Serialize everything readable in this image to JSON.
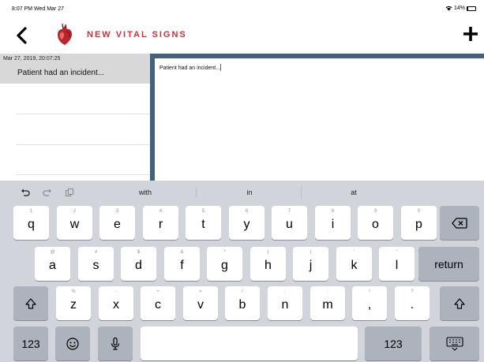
{
  "status_bar": {
    "time": "8:07 PM  Wed Mar 27",
    "battery_text": "14%",
    "battery_level": 0.14
  },
  "nav": {
    "title": "NEW VITAL SIGNS",
    "back_icon": "chevron-left-icon",
    "logo_icon": "heart-icon",
    "add_icon": "plus-icon"
  },
  "list": {
    "items": [
      {
        "date": "Mar 27, 2019, 20:07:25",
        "preview": "Patient had an incident..."
      }
    ]
  },
  "detail": {
    "text": "Patient had an incident..."
  },
  "keyboard": {
    "suggestions": [
      "with",
      "in",
      "at"
    ],
    "row1": [
      {
        "hint": "1",
        "key": "q"
      },
      {
        "hint": "2",
        "key": "w"
      },
      {
        "hint": "3",
        "key": "e"
      },
      {
        "hint": "4",
        "key": "r"
      },
      {
        "hint": "5",
        "key": "t"
      },
      {
        "hint": "6",
        "key": "y"
      },
      {
        "hint": "7",
        "key": "u"
      },
      {
        "hint": "8",
        "key": "i"
      },
      {
        "hint": "9",
        "key": "o"
      },
      {
        "hint": "0",
        "key": "p"
      }
    ],
    "row2": [
      {
        "hint": "@",
        "key": "a"
      },
      {
        "hint": "#",
        "key": "s"
      },
      {
        "hint": "$",
        "key": "d"
      },
      {
        "hint": "&",
        "key": "f"
      },
      {
        "hint": "*",
        "key": "g"
      },
      {
        "hint": "(",
        "key": "h"
      },
      {
        "hint": ")",
        "key": "j"
      },
      {
        "hint": "'",
        "key": "k"
      },
      {
        "hint": "\"",
        "key": "l"
      }
    ],
    "row3": [
      {
        "hint": "%",
        "key": "z"
      },
      {
        "hint": "-",
        "key": "x"
      },
      {
        "hint": "+",
        "key": "c"
      },
      {
        "hint": "=",
        "key": "v"
      },
      {
        "hint": "/",
        "key": "b"
      },
      {
        "hint": ";",
        "key": "n"
      },
      {
        "hint": ":",
        "key": "m"
      },
      {
        "hint": "!",
        "key": ","
      },
      {
        "hint": "?",
        "key": "."
      }
    ],
    "return_label": "return",
    "numbers_label": "123",
    "icons": {
      "undo": "undo-icon",
      "redo": "redo-icon",
      "paste": "paste-icon",
      "delete": "delete-icon",
      "shift": "shift-icon",
      "emoji": "emoji-icon",
      "mic": "microphone-icon",
      "hide": "keyboard-hide-icon"
    }
  },
  "colors": {
    "accent": "#c8343a",
    "panel_border": "#43617f",
    "caret": "#2a64f5",
    "keyboard_bg": "#d1d4da",
    "dark_key": "#adb3bc"
  }
}
